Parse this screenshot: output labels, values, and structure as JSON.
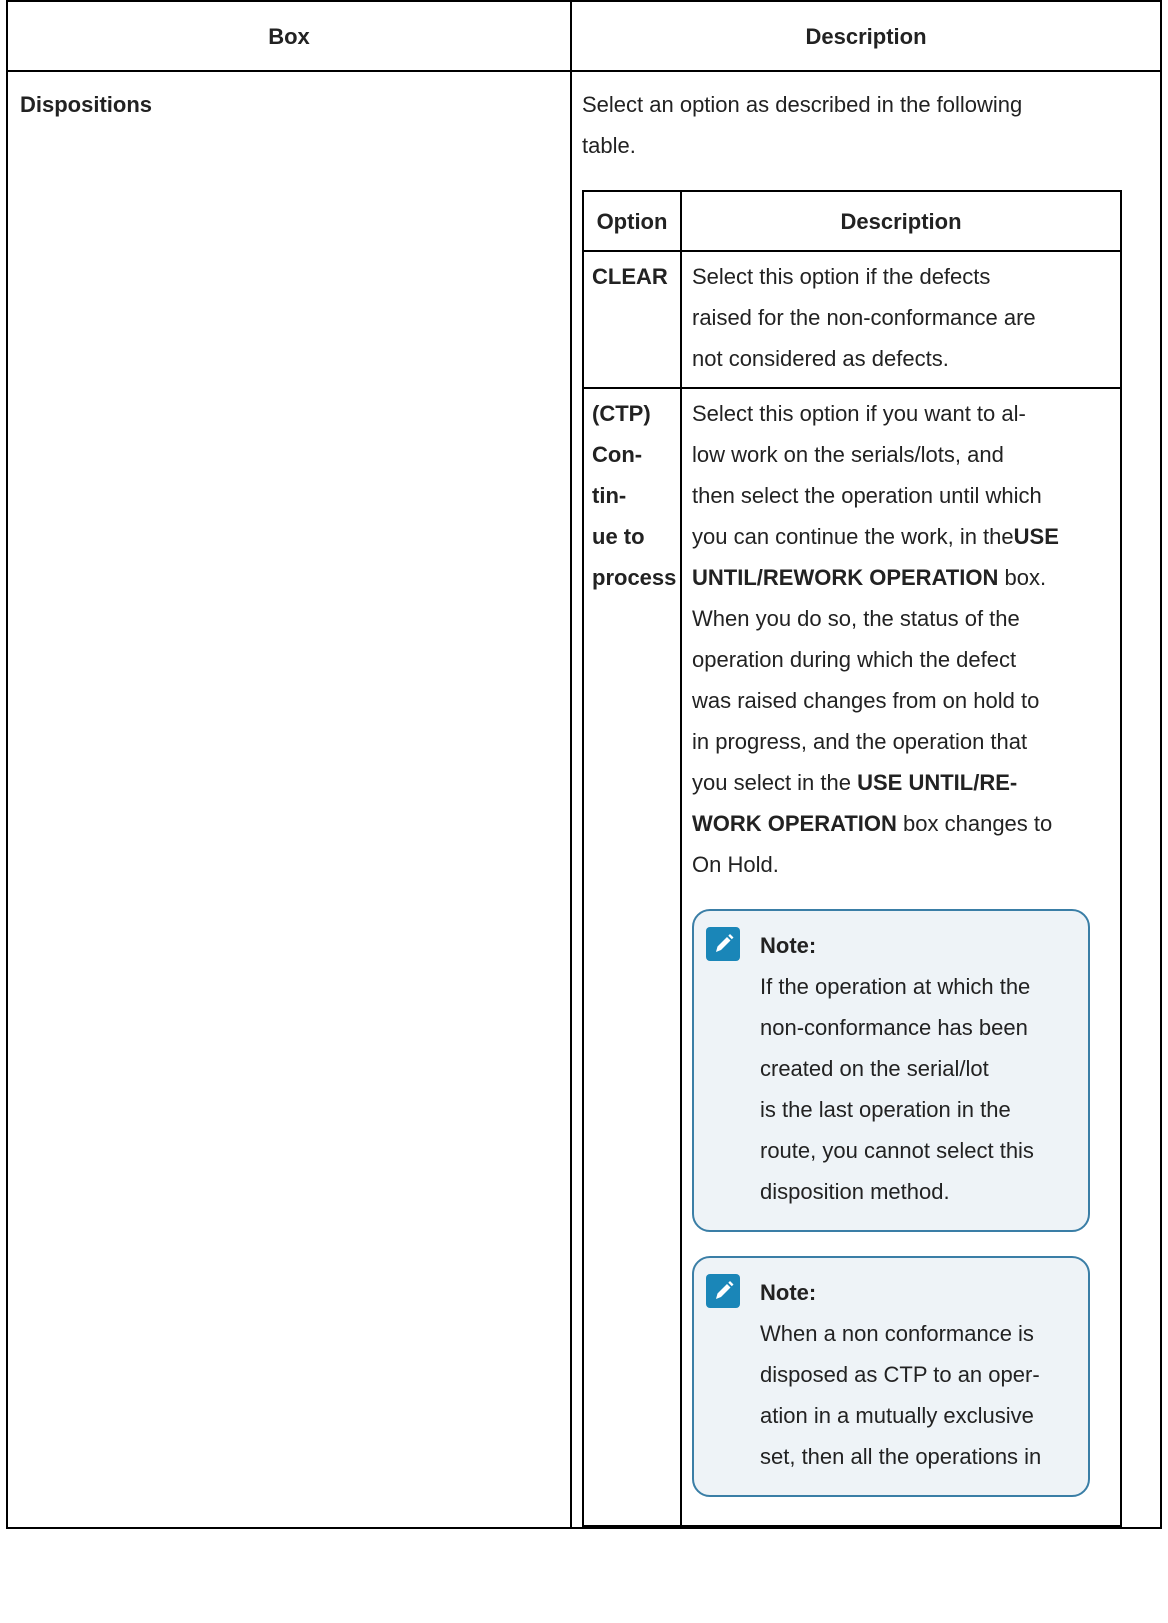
{
  "outer_table": {
    "headers": [
      "Box",
      "Description"
    ],
    "row": {
      "box": "Dispositions",
      "intro_lines": [
        "Select an option as described in the following",
        "table."
      ]
    }
  },
  "inner_table": {
    "headers": [
      "Option",
      "Description"
    ],
    "rows": [
      {
        "option_lines": [
          "CLEAR"
        ],
        "description_lines": [
          "Select this option if the defects",
          "raised for the non-conformance are",
          "not considered as defects."
        ]
      },
      {
        "option_lines": [
          "(CTP)",
          "Con-",
          "tin-",
          "ue to",
          "process"
        ],
        "description": {
          "line1": "Select this option if you want to al-",
          "line2": "low work on the serials/lots, and",
          "line3": "then select the operation until which",
          "line4_text": "you can continue the work, in the",
          "line4_bold": "USE",
          "line5_bold": "UNTIL/REWORK OPERATION",
          "line5_text": " box.",
          "line6": "When you do so, the status of the",
          "line7": "operation during which the defect",
          "line8": "was raised changes from on hold to",
          "line9": "in progress, and the operation that",
          "line10_text": "you select in the ",
          "line10_bold": "USE UNTIL/RE-",
          "line11_bold": "WORK OPERATION",
          "line11_text": " box changes to",
          "line12": "On Hold."
        },
        "notes": [
          {
            "icon": "pencil-note-icon",
            "title": "Note:",
            "lines": [
              "If the operation at which the",
              "non-conformance has been",
              "created on the serial/lot",
              "is the last operation in the",
              "route, you cannot select this",
              "disposition method."
            ]
          },
          {
            "icon": "pencil-note-icon",
            "title": "Note:",
            "lines": [
              "When a non conformance is",
              "disposed as CTP to an oper-",
              "ation in a mutually exclusive",
              "set, then all the operations in"
            ]
          }
        ]
      }
    ]
  },
  "colors": {
    "note_border": "#3a7ea6",
    "note_background": "#eef3f7",
    "note_icon": "#1a86b8",
    "table_border": "#000000"
  }
}
